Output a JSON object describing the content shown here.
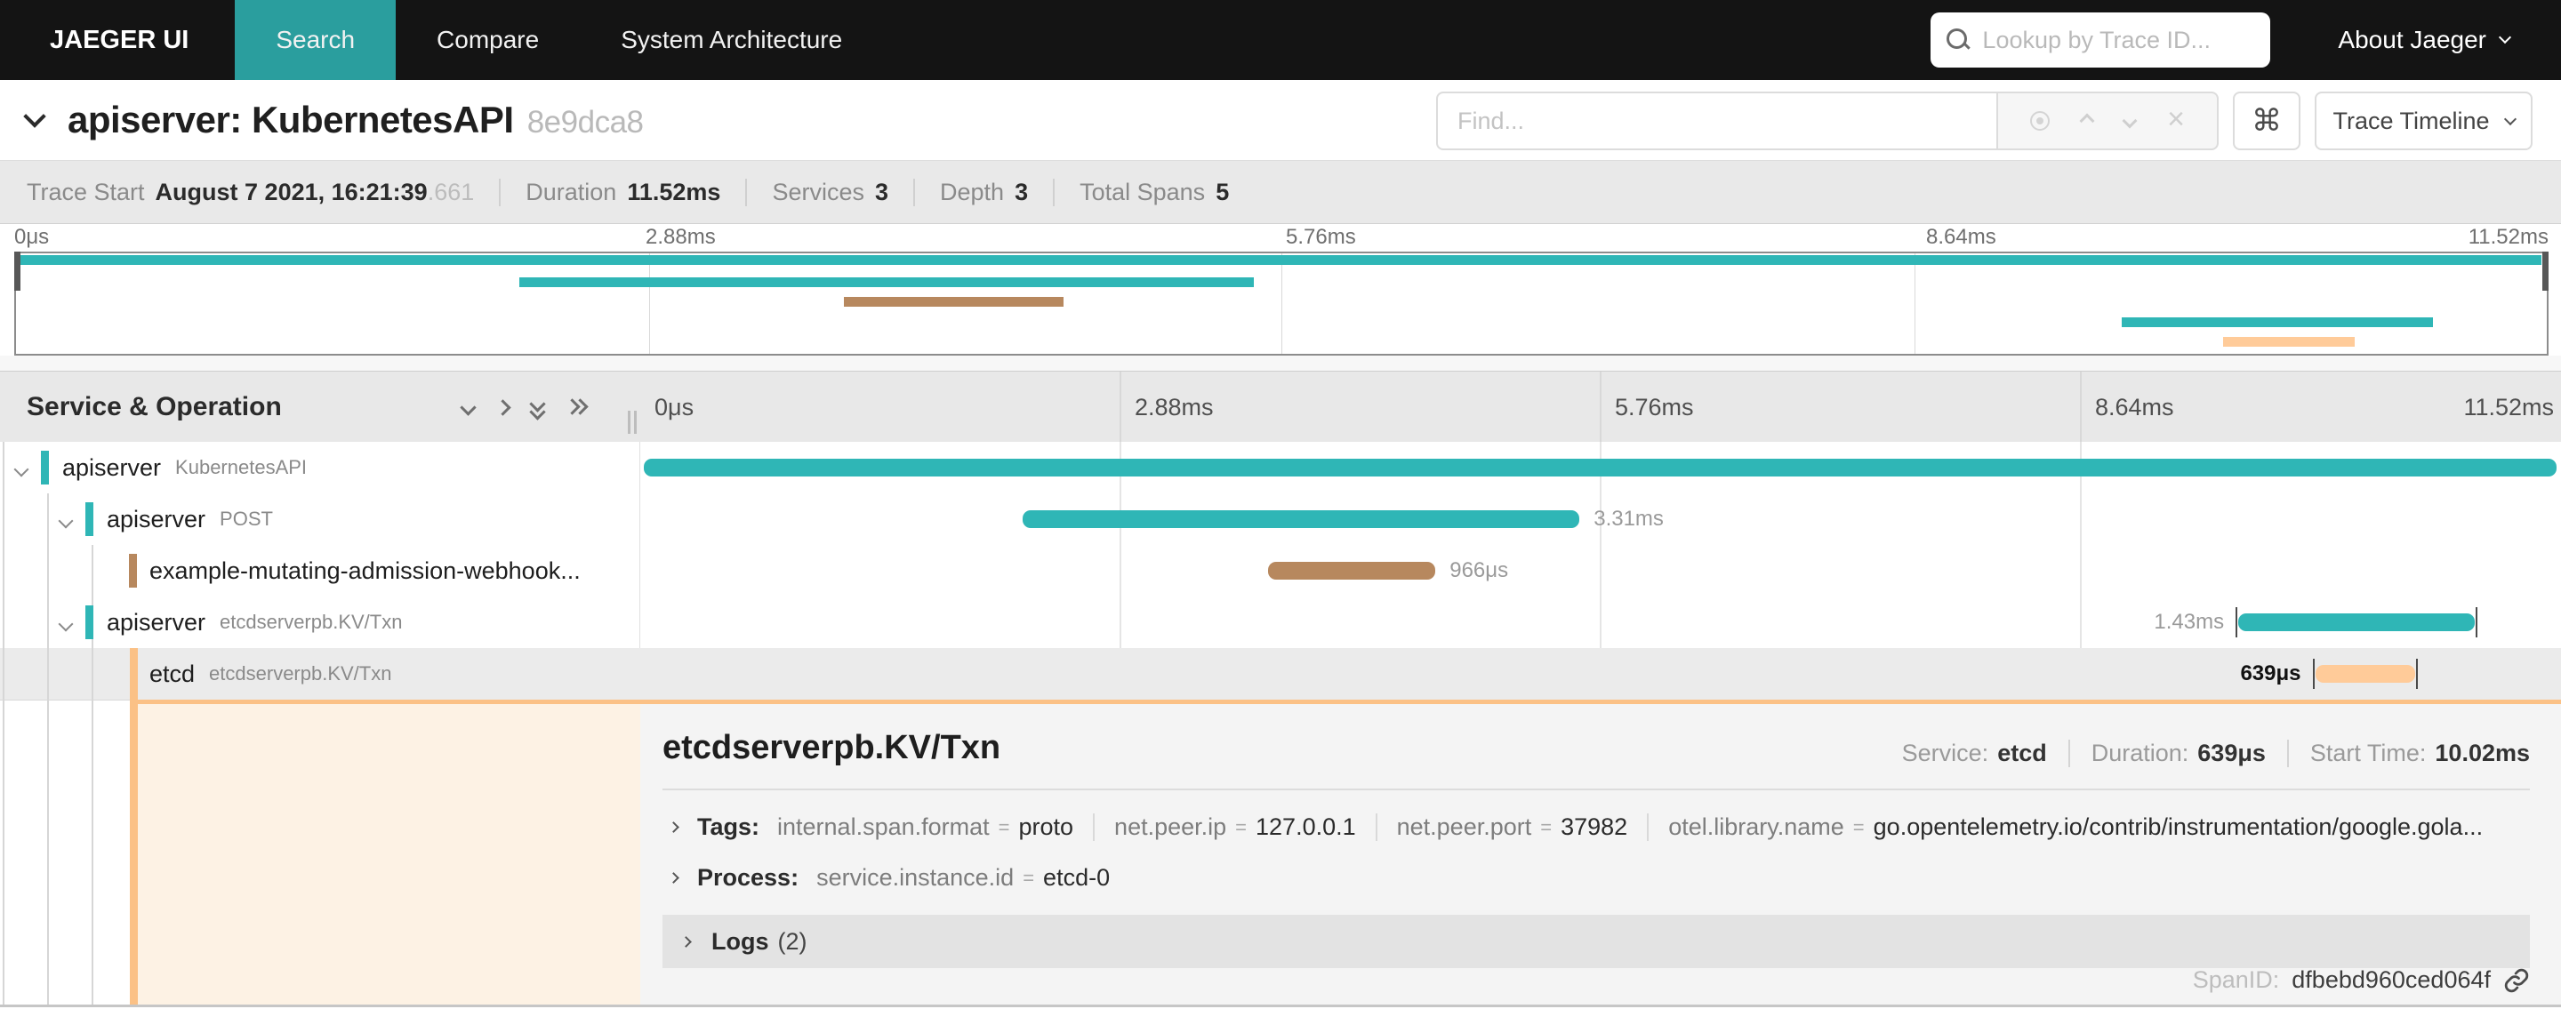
{
  "nav": {
    "brand": "JAEGER UI",
    "items": [
      {
        "label": "Search",
        "active": true
      },
      {
        "label": "Compare",
        "active": false
      },
      {
        "label": "System Architecture",
        "active": false
      }
    ],
    "lookup_placeholder": "Lookup by Trace ID...",
    "about_label": "About Jaeger"
  },
  "trace_header": {
    "title": "apiserver: KubernetesAPI",
    "trace_id_short": "8e9dca8",
    "find_placeholder": "Find...",
    "view_label": "Trace Timeline"
  },
  "trace_stats": {
    "items": [
      {
        "label": "Trace Start",
        "value": "August 7 2021, 16:21:39",
        "suffix": ".661"
      },
      {
        "label": "Duration",
        "value": "11.52ms",
        "suffix": ""
      },
      {
        "label": "Services",
        "value": "3",
        "suffix": ""
      },
      {
        "label": "Depth",
        "value": "3",
        "suffix": ""
      },
      {
        "label": "Total Spans",
        "value": "5",
        "suffix": ""
      }
    ]
  },
  "timeline": {
    "left_header": "Service & Operation",
    "ticks": [
      "0μs",
      "2.88ms",
      "5.76ms",
      "8.64ms",
      "11.52ms"
    ]
  },
  "spans": [
    {
      "service": "apiserver",
      "operation": "KubernetesAPI",
      "depth": 0,
      "color": "#2fb6b6",
      "start_pct": 0.18,
      "width_pct": 99.6,
      "duration_label": "",
      "label_side": "none",
      "selected": false
    },
    {
      "service": "apiserver",
      "operation": "POST",
      "depth": 1,
      "color": "#2fb6b6",
      "start_pct": 19.9,
      "width_pct": 29.0,
      "duration_label": "3.31ms",
      "label_side": "right",
      "selected": false
    },
    {
      "service": "example-mutating-admission-webhook...",
      "operation": "",
      "depth": 2,
      "color": "#b7885e",
      "start_pct": 32.7,
      "width_pct": 8.7,
      "duration_label": "966μs",
      "label_side": "right",
      "selected": false
    },
    {
      "service": "apiserver",
      "operation": "etcdserverpb.KV/Txn",
      "depth": 1,
      "color": "#2fb6b6",
      "start_pct": 83.2,
      "width_pct": 12.3,
      "duration_label": "1.43ms",
      "label_side": "left",
      "selected": false
    },
    {
      "service": "etcd",
      "operation": "etcdserverpb.KV/Txn",
      "depth": 2,
      "color": "#ffcb99",
      "start_pct": 87.2,
      "width_pct": 5.2,
      "duration_label": "639μs",
      "label_side": "left",
      "selected": true
    }
  ],
  "detail": {
    "title": "etcdserverpb.KV/Txn",
    "meta": [
      {
        "label": "Service:",
        "value": "etcd"
      },
      {
        "label": "Duration:",
        "value": "639μs"
      },
      {
        "label": "Start Time:",
        "value": "10.02ms"
      }
    ],
    "tags_label": "Tags:",
    "tags": [
      {
        "key": "internal.span.format",
        "value": "proto"
      },
      {
        "key": "net.peer.ip",
        "value": "127.0.0.1"
      },
      {
        "key": "net.peer.port",
        "value": "37982"
      },
      {
        "key": "otel.library.name",
        "value": "go.opentelemetry.io/contrib/instrumentation/google.gola..."
      }
    ],
    "process_label": "Process:",
    "process": {
      "key": "service.instance.id",
      "value": "etcd-0"
    },
    "logs_label": "Logs",
    "logs_count": "(2)",
    "spanid_label": "SpanID:",
    "span_id": "dfbebd960ced064f"
  }
}
